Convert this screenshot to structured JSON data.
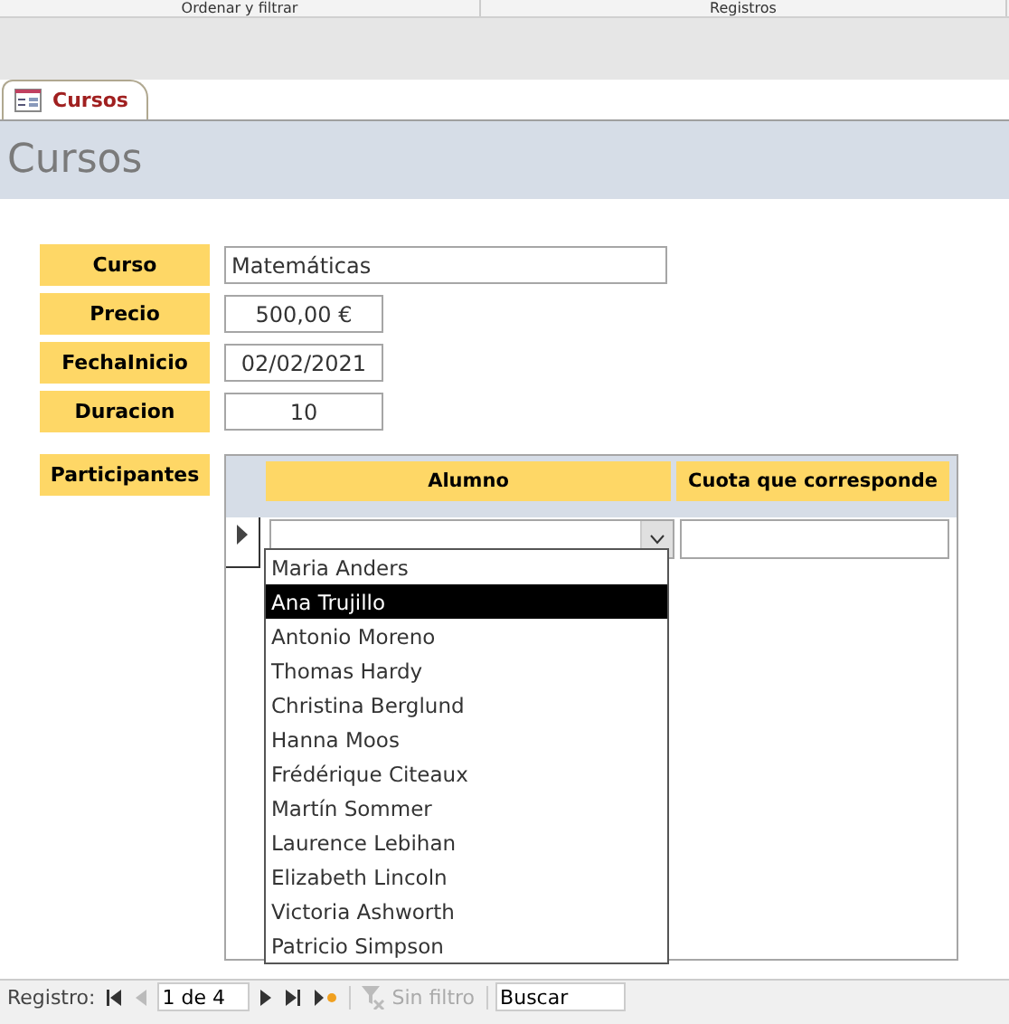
{
  "ribbon_groups": [
    "Ordenar y filtrar",
    "Registros"
  ],
  "tab": {
    "label": "Cursos",
    "selected": true
  },
  "header": {
    "title": "Cursos"
  },
  "fields": [
    {
      "label": "Curso",
      "value": "Matemáticas"
    },
    {
      "label": "Precio",
      "value": "500,00 €"
    },
    {
      "label": "FechaInicio",
      "value": "02/02/2021"
    },
    {
      "label": "Duracion",
      "value": "10"
    }
  ],
  "subform": {
    "label": "Participantes",
    "columns": [
      "Alumno",
      "Cuota que corresponde"
    ],
    "dropdown": {
      "expanded": true,
      "options": [
        {
          "label": "Maria Anders",
          "selected": false
        },
        {
          "label": "Ana Trujillo",
          "selected": true
        },
        {
          "label": "Antonio Moreno",
          "selected": false
        },
        {
          "label": "Thomas Hardy",
          "selected": false
        },
        {
          "label": "Christina Berglund",
          "selected": false
        },
        {
          "label": "Hanna Moos",
          "selected": false
        },
        {
          "label": "Frédérique Citeaux",
          "selected": false
        },
        {
          "label": "Martín Sommer",
          "selected": false
        },
        {
          "label": "Laurence Lebihan",
          "selected": false
        },
        {
          "label": "Elizabeth Lincoln",
          "selected": false
        },
        {
          "label": "Victoria Ashworth",
          "selected": false
        },
        {
          "label": "Patricio Simpson",
          "selected": false
        }
      ]
    }
  },
  "navigation": {
    "label": "Registro:",
    "position": "1 de 4",
    "filter": "Sin filtro",
    "search": "Buscar"
  }
}
